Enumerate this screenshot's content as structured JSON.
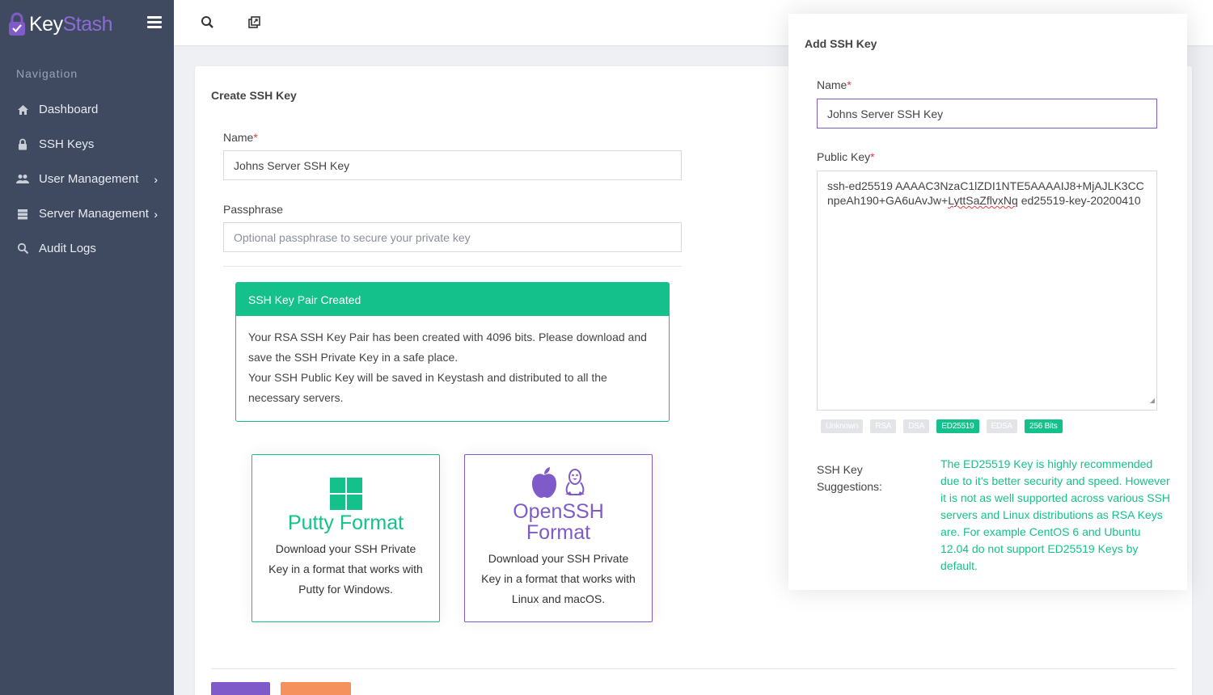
{
  "app": {
    "brand_part1": "Key",
    "brand_part2": "Stash",
    "accent_color": "#7e5bc8",
    "success_color": "#15c18a",
    "sidebar_color": "#3f4a60"
  },
  "sidebar": {
    "heading": "Navigation",
    "items": [
      {
        "label": "Dashboard",
        "icon": "home-icon",
        "has_submenu": false
      },
      {
        "label": "SSH Keys",
        "icon": "lock-icon",
        "has_submenu": false
      },
      {
        "label": "User Management",
        "icon": "users-icon",
        "has_submenu": true
      },
      {
        "label": "Server Management",
        "icon": "server-icon",
        "has_submenu": true
      },
      {
        "label": "Audit Logs",
        "icon": "audit-search-icon",
        "has_submenu": false
      }
    ]
  },
  "topbar": {
    "icons": [
      "search-icon",
      "external-window-icon"
    ]
  },
  "create_form": {
    "title": "Create SSH Key",
    "name_label": "Name",
    "required_mark": "*",
    "name_value": "Johns Server SSH Key",
    "passphrase_label": "Passphrase",
    "passphrase_placeholder": "Optional passphrase to secure your private key",
    "alert": {
      "title": "SSH Key Pair Created",
      "line1": "Your RSA SSH Key Pair has been created with 4096 bits. Please download and save the SSH Private Key in a safe place.",
      "line2": "Your SSH Public Key will be saved in Keystash and distributed to all the necessary servers."
    },
    "putty": {
      "icon": "windows-icon",
      "title": "Putty Format",
      "description": "Download your SSH Private Key in a format that works with Putty for Windows."
    },
    "openssh": {
      "icons": [
        "apple-icon",
        "linux-icon"
      ],
      "title_line1": "OpenSSH",
      "title_line2": "Format",
      "description": "Download your SSH Private Key in a format that works with Linux and macOS."
    }
  },
  "modal": {
    "title": "Add SSH Key",
    "name_label": "Name",
    "required_mark": "*",
    "name_value": "Johns Server SSH Key",
    "public_key_label": "Public Key",
    "public_key_part1": "ssh-ed25519 AAAAC3NzaC1lZDI1NTE5AAAAIJ8+MjAJLK3CCnpeAh190+GA6uAvJw+",
    "public_key_misspelled": "LyttSaZflvxNq",
    "public_key_part2": " ed25519-key-20200410",
    "key_types": [
      {
        "label": "Unknown",
        "active": false
      },
      {
        "label": "RSA",
        "active": false
      },
      {
        "label": "DSA",
        "active": false
      },
      {
        "label": "ED25519",
        "active": true
      },
      {
        "label": "EDSA",
        "active": false
      },
      {
        "label": "256 Bits",
        "active": true
      }
    ],
    "suggestions_label": "SSH Key Suggestions:",
    "suggestions_text": "The ED25519 Key is highly recommended due to it's better security and speed. However it is not as well supported across various SSH servers and Linux distributions as RSA Keys are. For example CentOS 6 and Ubuntu 12.04 do not support ED25519 Keys by default."
  }
}
